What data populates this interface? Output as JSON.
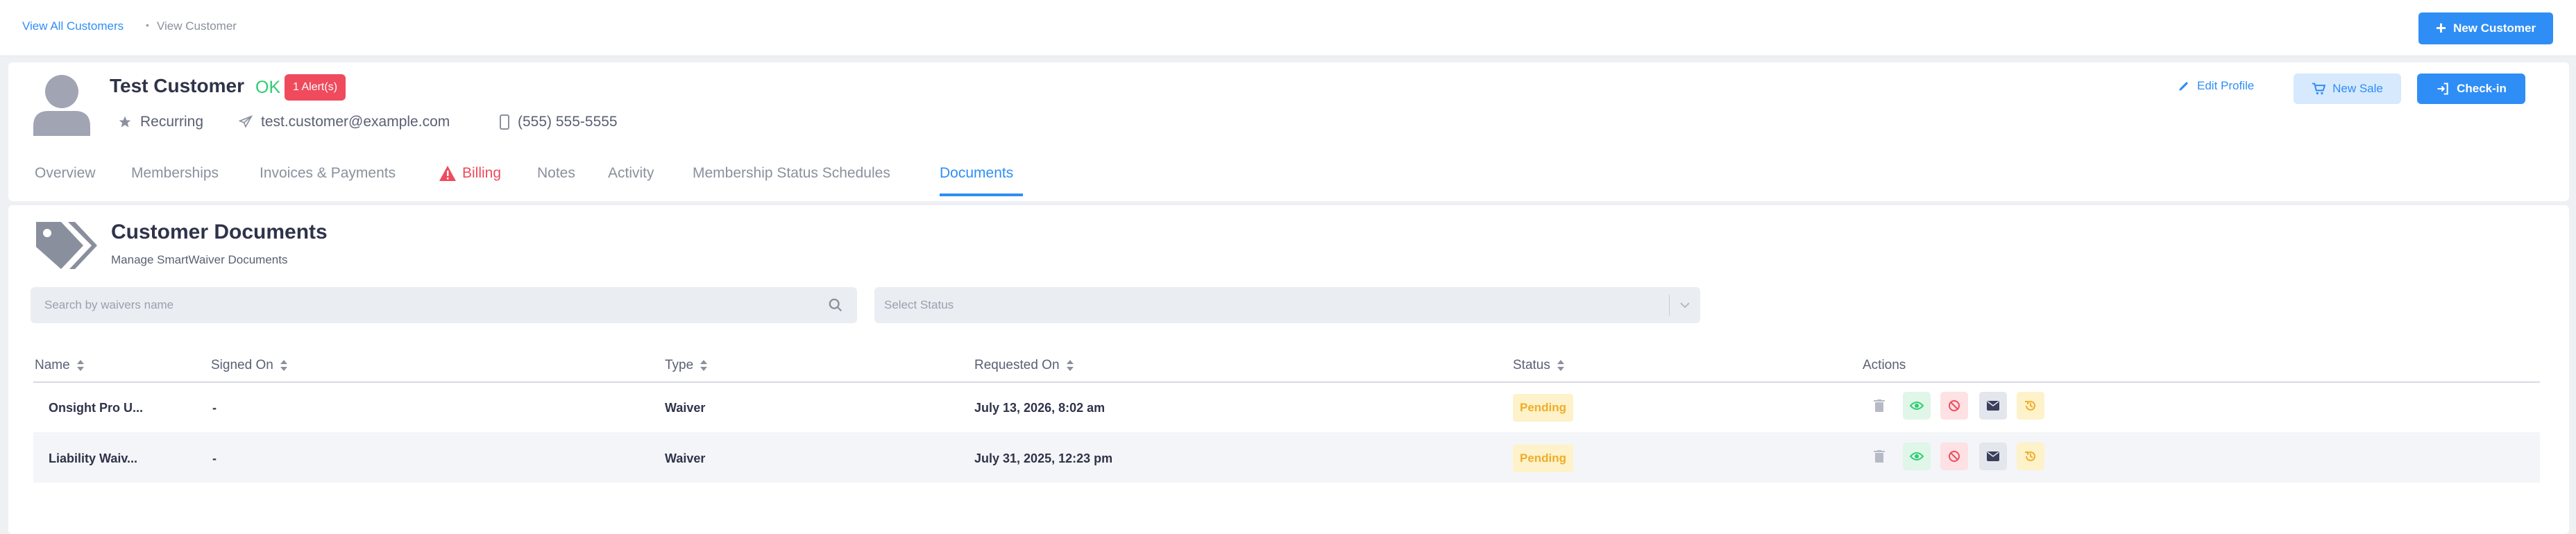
{
  "breadcrumb": {
    "parent": "View All Customers",
    "separator": "•",
    "current": "View Customer"
  },
  "header": {
    "new_customer_label": "New Customer"
  },
  "customer": {
    "name": "Test Customer",
    "status": "OK",
    "alert_badge": "1 Alert(s)",
    "membership_type": "Recurring",
    "email": "test.customer@example.com",
    "phone": "(555) 555-5555"
  },
  "profile_actions": {
    "edit": "Edit Profile",
    "new_sale": "New Sale",
    "check_in": "Check-in"
  },
  "tabs": [
    {
      "label": "Overview"
    },
    {
      "label": "Memberships"
    },
    {
      "label": "Invoices & Payments"
    },
    {
      "label": "Billing"
    },
    {
      "label": "Notes"
    },
    {
      "label": "Activity"
    },
    {
      "label": "Membership Status Schedules"
    },
    {
      "label": "Documents"
    }
  ],
  "active_tab": "Documents",
  "documents": {
    "title": "Customer Documents",
    "subtitle": "Manage SmartWaiver Documents",
    "search_placeholder": "Search by waivers name",
    "status_placeholder": "Select Status",
    "columns": [
      "Name",
      "Signed On",
      "Type",
      "Requested On",
      "Status",
      "Actions"
    ],
    "rows": [
      {
        "name": "Onsight Pro U...",
        "signed_on": "-",
        "type": "Waiver",
        "requested_on": "July 13, 2026, 8:02 am",
        "status": "Pending"
      },
      {
        "name": "Liability Waiv...",
        "signed_on": "-",
        "type": "Waiver",
        "requested_on": "July 31, 2025, 12:23 pm",
        "status": "Pending"
      }
    ],
    "actions": [
      "trash-icon",
      "eye-icon",
      "ban-icon",
      "envelope-icon",
      "history-icon"
    ]
  },
  "colors": {
    "accent": "#2f8ef5",
    "danger": "#ef4b5c",
    "success": "#2ecc71",
    "warning": "#f0ad2b"
  }
}
